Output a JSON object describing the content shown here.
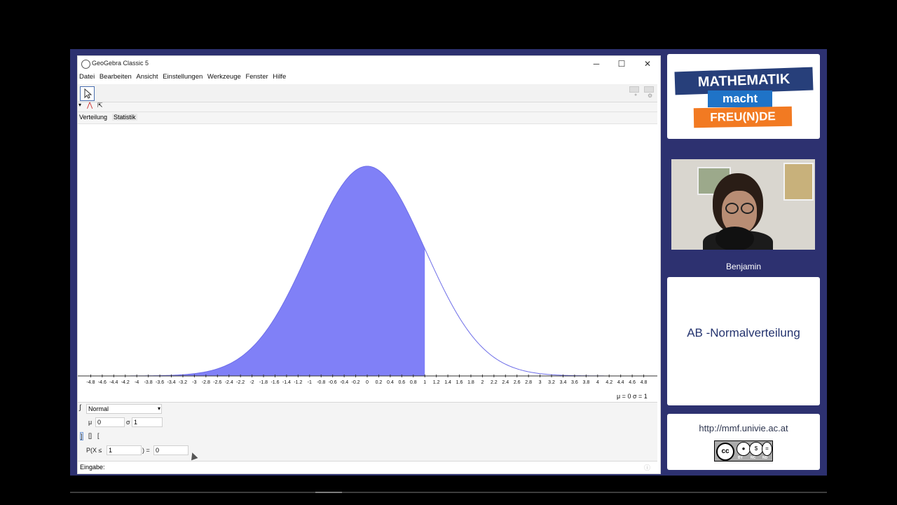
{
  "window": {
    "title": "GeoGebra Classic 5",
    "controls": [
      "─",
      "☐",
      "✕"
    ]
  },
  "menu": [
    "Datei",
    "Bearbeiten",
    "Ansicht",
    "Einstellungen",
    "Werkzeuge",
    "Fenster",
    "Hilfe"
  ],
  "tabs": [
    "Verteilung",
    "Statistik"
  ],
  "controls": {
    "distribution": "Normal",
    "mu_label": "μ",
    "mu_value": "0",
    "sigma_label": "σ",
    "sigma_value": "1",
    "prob_prefix": "P(X ≤",
    "prob_bound": "1",
    "prob_suffix": ") =",
    "prob_value": "0",
    "input_label": "Eingabe:"
  },
  "plot_params": "μ = 0    σ = 1",
  "chart_data": {
    "type": "area",
    "function": "normal_pdf",
    "mu": 0,
    "sigma": 1,
    "shade_upper": 1,
    "xlim": [
      -5,
      5
    ],
    "tick_labels": [
      "-4.8",
      "-4.6",
      "-4.4",
      "-4.2",
      "-4",
      "-3.8",
      "-3.6",
      "-3.4",
      "-3.2",
      "-3",
      "-2.8",
      "-2.6",
      "-2.4",
      "-2.2",
      "-2",
      "-1.8",
      "-1.6",
      "-1.4",
      "-1.2",
      "-1",
      "-0.8",
      "-0.6",
      "-0.4",
      "-0.2",
      "0",
      "0.2",
      "0.4",
      "0.6",
      "0.8",
      "1",
      "1.2",
      "1.4",
      "1.6",
      "1.8",
      "2",
      "2.2",
      "2.4",
      "2.6",
      "2.8",
      "3",
      "3.2",
      "3.4",
      "3.6",
      "3.8",
      "4",
      "4.2",
      "4.4",
      "4.6",
      "4.8"
    ],
    "fill_color": "#8080f7",
    "line_color": "#6e6ee8"
  },
  "sidebar": {
    "logo_lines": [
      "MATHEMATIK",
      "macht",
      "FREU(N)DE"
    ],
    "presenter": "Benjamin",
    "topic": "AB -Normalverteilung",
    "url": "http://mmf.univie.ac.at",
    "license": [
      "cc",
      "BY",
      "NC",
      "ND"
    ]
  },
  "colors": {
    "frame": "#2d3170",
    "logo_blue": "#273f7a",
    "logo_mid": "#1f73c7",
    "logo_orange": "#f27a22"
  }
}
